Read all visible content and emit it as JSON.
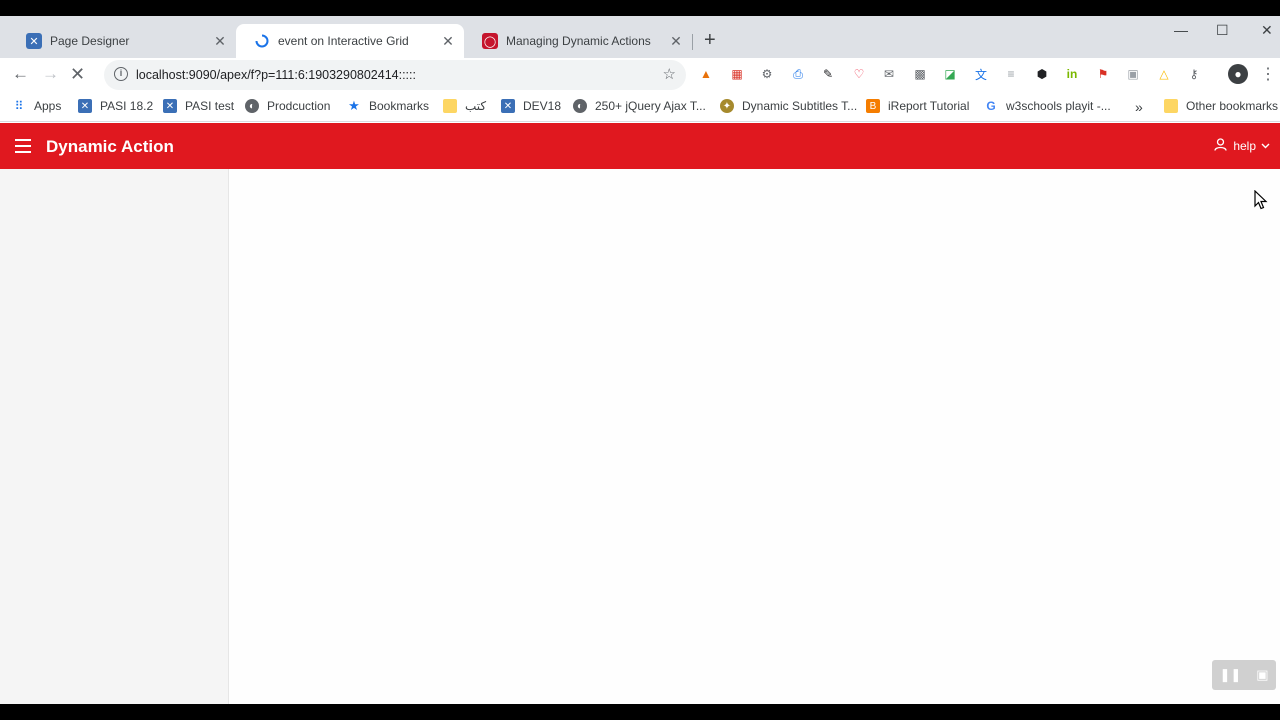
{
  "browser": {
    "tabs": [
      {
        "title": "Page Designer",
        "favicon": "apex-icon",
        "active": false
      },
      {
        "title": "event on Interactive Grid",
        "favicon": "loading-spinner-icon",
        "active": true
      },
      {
        "title": "Managing Dynamic Actions",
        "favicon": "oracle-icon",
        "active": false
      }
    ],
    "new_tab": "+",
    "window_controls": {
      "minimize": "—",
      "maximize": "☐",
      "close": "✕"
    },
    "url": "localhost:9090/apex/f?p=111:6:1903290802414:::::",
    "bookmarks": [
      {
        "label": "Apps",
        "icon": "apps-grid-icon"
      },
      {
        "label": "PASI 18.2",
        "icon": "apex-icon"
      },
      {
        "label": "PASI test",
        "icon": "apex-icon"
      },
      {
        "label": "Prodcuction",
        "icon": "globe-icon"
      },
      {
        "label": "Bookmarks",
        "icon": "star-icon"
      },
      {
        "label": "كتب",
        "icon": "folder-icon"
      },
      {
        "label": "DEV18",
        "icon": "apex-icon"
      },
      {
        "label": "250+ jQuery Ajax T...",
        "icon": "globe-icon"
      },
      {
        "label": "Dynamic Subtitles T...",
        "icon": "badge-icon"
      },
      {
        "label": "iReport Tutorial",
        "icon": "blogger-icon"
      },
      {
        "label": "w3schools playit -...",
        "icon": "google-icon"
      }
    ],
    "bookmarks_overflow": "»",
    "other_bookmarks": "Other bookmarks"
  },
  "app": {
    "title": "Dynamic Action",
    "user_label": "help"
  },
  "colors": {
    "header": "#e0181f",
    "sidebar": "#f5f5f5",
    "tabstrip": "#dee1e6"
  }
}
